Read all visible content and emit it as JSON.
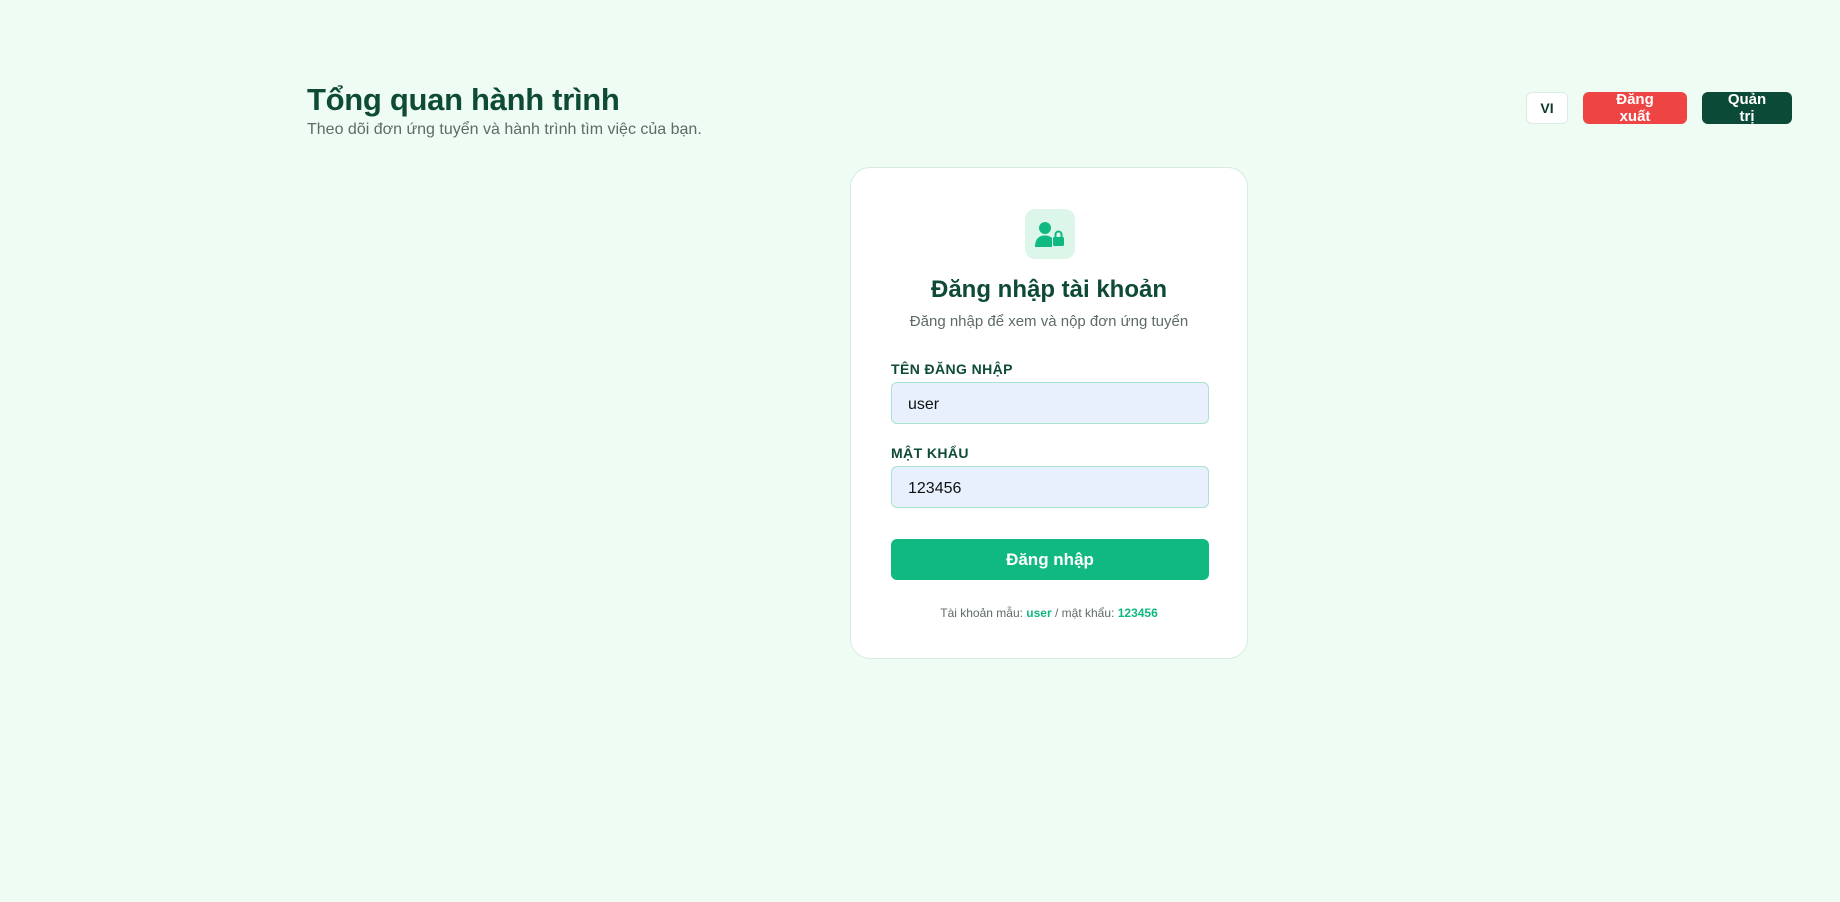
{
  "header": {
    "title": "Tổng quan hành trình",
    "subtitle": "Theo dõi đơn ứng tuyển và hành trình tìm việc của bạn."
  },
  "top_actions": {
    "language": "VI",
    "logout": "Đăng xuất",
    "admin": "Quản trị"
  },
  "login_card": {
    "icon": "user-lock-icon",
    "title": "Đăng nhập tài khoản",
    "subtitle": "Đăng nhập để xem và nộp đơn ứng tuyển",
    "username_label": "TÊN ĐĂNG NHẬP",
    "username_value": "user",
    "password_label": "MẬT KHẨU",
    "password_value": "123456",
    "submit_label": "Đăng nhập",
    "hint": {
      "account_prefix": "Tài khoản mẫu:",
      "account_value": "user",
      "password_prefix": "/ mật khẩu:",
      "password_value": "123456"
    }
  },
  "colors": {
    "background": "#eefcf4",
    "primary": "#10b981",
    "dark_green": "#0b4a36",
    "danger": "#ef4444"
  }
}
